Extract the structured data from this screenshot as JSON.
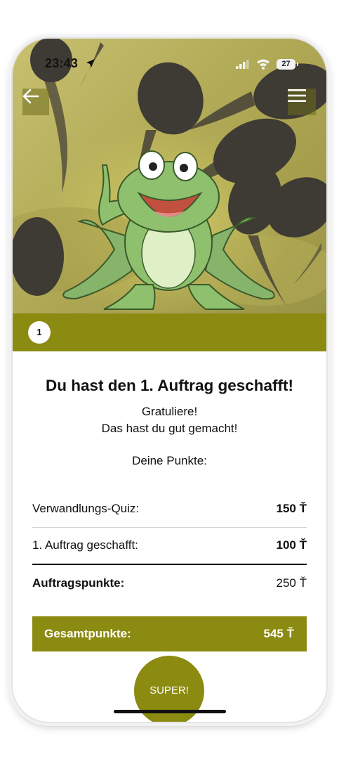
{
  "status_bar": {
    "time": "23:43",
    "battery": "27",
    "icons": [
      "location-arrow-icon",
      "signal-icon",
      "wifi-icon",
      "battery-icon"
    ]
  },
  "header": {
    "back_icon": "arrow-left-icon",
    "menu_icon": "hamburger-menu-icon"
  },
  "hero": {
    "image": "cartoon frog among tadpoles"
  },
  "step": {
    "number": "1"
  },
  "result": {
    "title": "Du hast den 1. Auftrag geschafft!",
    "congrats_line1": "Gratuliere!",
    "congrats_line2": "Das hast du gut gemacht!",
    "points_heading": "Deine Punkte:"
  },
  "points": {
    "rows": [
      {
        "label": "Verwandlungs-Quiz:",
        "value": "150 Ť"
      },
      {
        "label": "1. Auftrag geschafft:",
        "value": "100 Ť"
      },
      {
        "label": "Auftragspunkte:",
        "value": "250 Ť"
      }
    ],
    "total": {
      "label": "Gesamtpunkte:",
      "value": "545 Ť"
    }
  },
  "actions": {
    "super_label": "SUPER!"
  },
  "colors": {
    "accent": "#8b8a11",
    "text": "#111111",
    "background": "#ffffff"
  }
}
